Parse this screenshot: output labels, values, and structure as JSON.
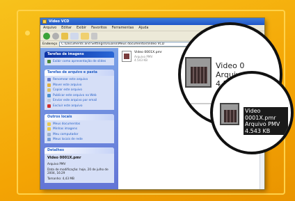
{
  "window": {
    "title": "Vídeo VCD",
    "menus": [
      "Arquivo",
      "Editar",
      "Exibir",
      "Favoritos",
      "Ferramentas",
      "Ajuda"
    ],
    "address_label": "Endereço",
    "address_value": "C:\\Documents and Settings\\Usuario\\Meus documentos\\Video VCD"
  },
  "taskpane": {
    "video_tasks": {
      "header": "Tarefas de imagens",
      "items": [
        "Exibir como apresentação de slides"
      ]
    },
    "file_tasks": {
      "header": "Tarefas de arquivo e pasta",
      "items": [
        "Renomear este arquivo",
        "Mover este arquivo",
        "Copiar este arquivo",
        "Publicar este arquivo na Web",
        "Enviar este arquivo por email",
        "Excluir este arquivo"
      ]
    },
    "other_places": {
      "header": "Outros locais",
      "items": [
        "Meus documentos",
        "Minhas imagens",
        "Meu computador",
        "Meus locais de rede"
      ]
    },
    "details": {
      "header": "Detalhes",
      "filename": "Video 0001X.pmr",
      "type": "Arquivo PMV",
      "modified": "Data de modificação: hoje, 20 de julho de 2004, 16:29",
      "size": "Tamanho: 4,43 MB"
    }
  },
  "file": {
    "name": "Video 0001X.pmr",
    "type": "Arquivo PMV",
    "size": "4.543 KB"
  },
  "lens_large": {
    "line1": "Video 0",
    "line2": "Arquiv",
    "line3": "4.5"
  },
  "lens_small": {
    "line1": "Video 0001X.pmr",
    "line2": "Arquivo PMV",
    "line3": "4.543 KB"
  },
  "colors": {
    "background": "#f4a404",
    "taskpane": "#6f8ee0",
    "titlebar": "#2a62d0"
  }
}
